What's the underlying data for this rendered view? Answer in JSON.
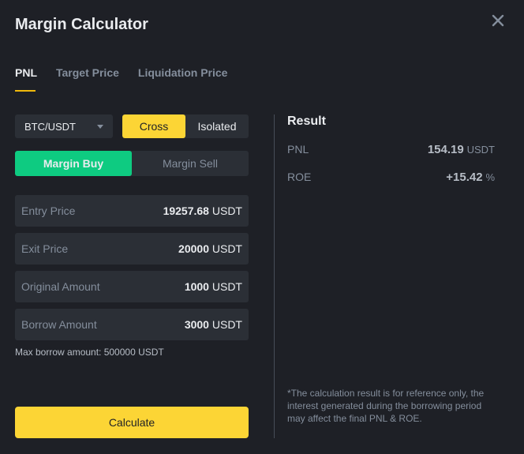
{
  "modal": {
    "title": "Margin Calculator",
    "close_icon": "close-icon"
  },
  "tabs": [
    {
      "label": "PNL",
      "active": true
    },
    {
      "label": "Target Price",
      "active": false
    },
    {
      "label": "Liquidation Price",
      "active": false
    }
  ],
  "pair_select": {
    "value": "BTC/USDT",
    "icon": "caret-down-icon"
  },
  "margin_mode": {
    "options": [
      "Cross",
      "Isolated"
    ],
    "selected": "Cross"
  },
  "side": {
    "options": [
      "Margin Buy",
      "Margin Sell"
    ],
    "selected": "Margin Buy"
  },
  "fields": [
    {
      "label": "Entry Price",
      "value": "19257.68",
      "unit": "USDT"
    },
    {
      "label": "Exit Price",
      "value": "20000",
      "unit": "USDT"
    },
    {
      "label": "Original Amount",
      "value": "1000",
      "unit": "USDT"
    },
    {
      "label": "Borrow Amount",
      "value": "3000",
      "unit": "USDT"
    }
  ],
  "max_borrow": "Max borrow amount: 500000 USDT",
  "calculate_label": "Calculate",
  "result": {
    "title": "Result",
    "rows": [
      {
        "label": "PNL",
        "value": "154.19",
        "unit": "USDT"
      },
      {
        "label": "ROE",
        "value": "+15.42",
        "unit": "%"
      }
    ],
    "note": "*The calculation result is for reference only, the interest generated during the borrowing period may affect the final PNL & ROE."
  },
  "colors": {
    "background": "#1e2026",
    "panel": "#2b2f36",
    "accent_yellow": "#fcd535",
    "buy_green": "#0ecb81",
    "tab_underline": "#f0b90b"
  }
}
